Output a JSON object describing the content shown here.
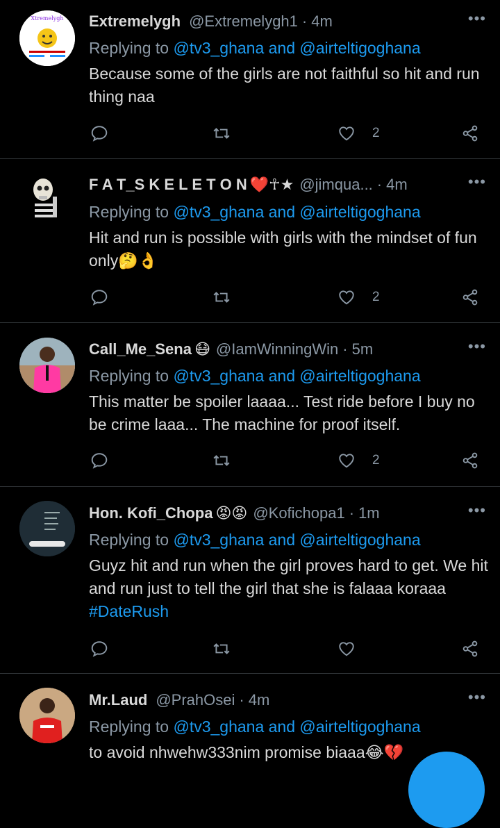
{
  "tweets": [
    {
      "name": "Extremelygh",
      "name_emoji": "",
      "handle": "@Extremelygh1",
      "time": "4m",
      "replying_prefix": "Replying to",
      "replying_to": "@tv3_ghana and @airteltigoghana",
      "body": "Because some of the girls are not faithful so hit and run thing naa",
      "hashtag": "",
      "like_count": "2",
      "avatar": "extremelygh-logo"
    },
    {
      "name": "F A T_S K E L E T O N",
      "name_emoji": "❤️☥★",
      "handle": "@jimqua...",
      "time": "4m",
      "replying_prefix": "Replying to",
      "replying_to": "@tv3_ghana and @airteltigoghana",
      "body": "Hit and run is possible with girls with the mindset of fun only🤔👌",
      "hashtag": "",
      "like_count": "2",
      "avatar": "skeleton"
    },
    {
      "name": "Call_Me_Sena",
      "name_emoji": "😷",
      "handle": "@IamWinningWin",
      "time": "5m",
      "replying_prefix": "Replying to",
      "replying_to": "@tv3_ghana and @airteltigoghana",
      "body": "This matter be spoiler laaaa...  Test ride before I buy no be crime laaa...  The machine for proof itself.",
      "hashtag": "",
      "like_count": "2",
      "avatar": "man-pink-shirt"
    },
    {
      "name": "Hon. Kofi_Chopa",
      "name_emoji": "😡😡",
      "handle": "@Kofichopa1",
      "time": "1m",
      "replying_prefix": "Replying to",
      "replying_to": "@tv3_ghana and @airteltigoghana",
      "body": "Guyz hit and run when the girl proves hard to get. We hit and run just to tell the girl that she is falaaa koraaa",
      "hashtag": "#DateRush",
      "like_count": "",
      "avatar": "dark-menu"
    },
    {
      "name": "Mr.Laud",
      "name_emoji": "",
      "handle": "@PrahOsei",
      "time": "4m",
      "replying_prefix": "Replying to",
      "replying_to": "@tv3_ghana and @airteltigoghana",
      "body": "to avoid nhwehw333nim promise  biaaa😂💔",
      "hashtag": "",
      "like_count": "",
      "avatar": "man-red-shirt"
    }
  ],
  "ui": {
    "more_glyph": "•••",
    "separator": "·",
    "colors": {
      "link": "#1d9bf0",
      "muted": "#8b98a5",
      "text": "#d9d9d9",
      "bg": "#000000",
      "divider": "#2f3336"
    }
  }
}
